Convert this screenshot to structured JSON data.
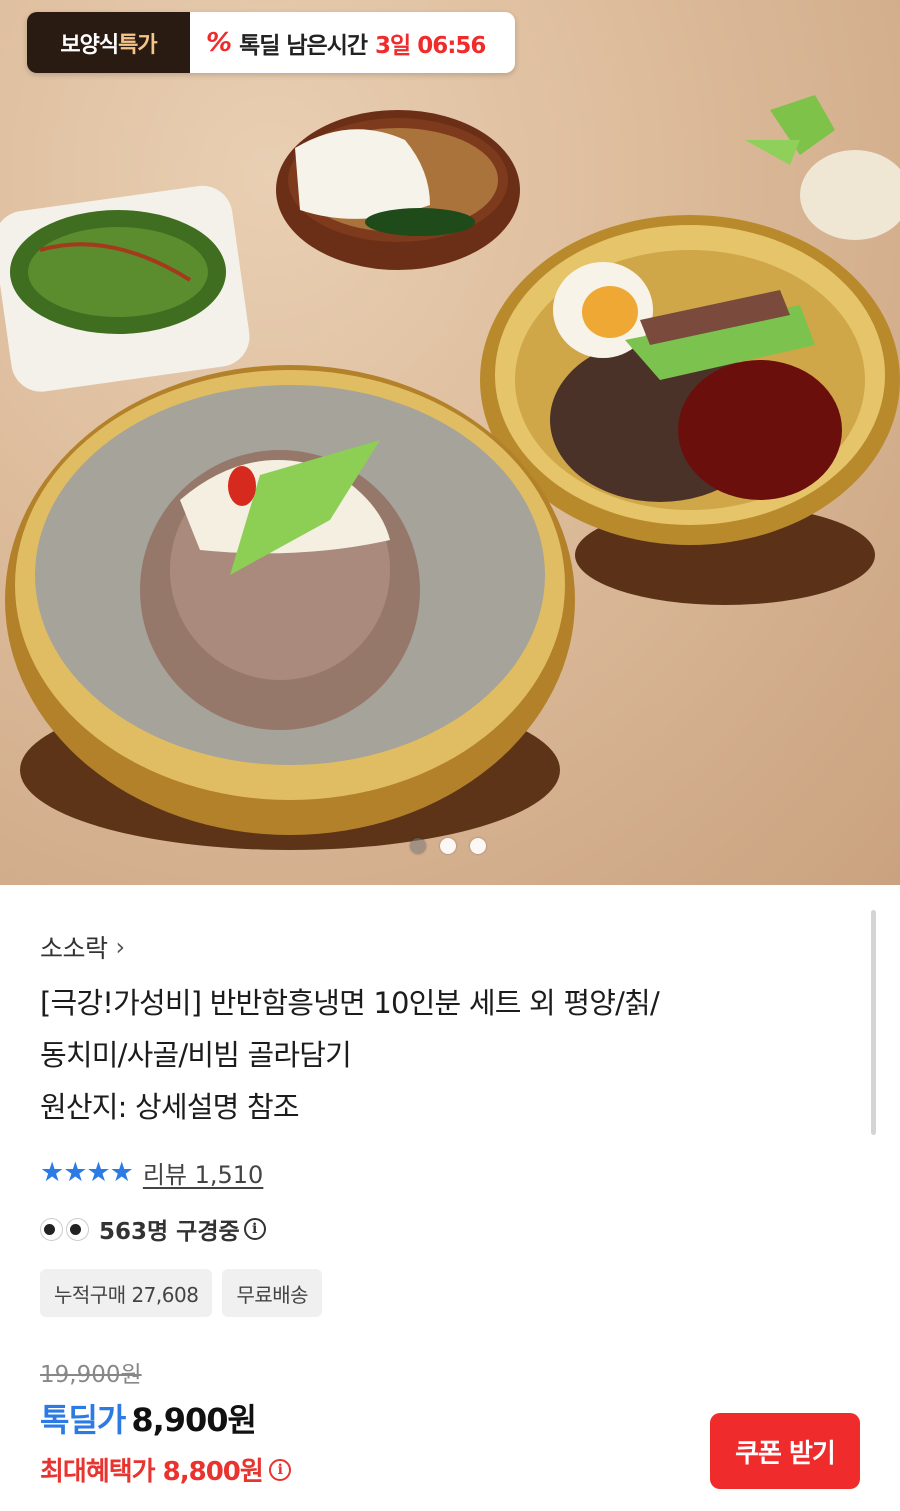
{
  "promo": {
    "brand_a": "보양식",
    "brand_b": "특가",
    "percent_icon": "%",
    "deal_label": "톡딜 남은시간",
    "time_left": "3일 06:56"
  },
  "carousel": {
    "total": 3,
    "active_index": 0
  },
  "product": {
    "seller": "소소락",
    "seller_chevron": "›",
    "title_line1": "[극강!가성비] 반반함흥냉면 10인분 세트 외 평양/칡/",
    "title_line2": "동치미/사골/비빔 골라담기",
    "title_line3": "원산지: 상세설명 참조",
    "stars": "★★★★",
    "rating_value": 4,
    "review_text": "리뷰 1,510",
    "watching_text": "563명 구경중",
    "tags": [
      "누적구매 27,608",
      "무료배송"
    ],
    "original_price": "19,900원",
    "deal_label": "톡딜가",
    "deal_price": "8,900원",
    "max_benefit": "최대혜택가 8,800원",
    "coupon_button": "쿠폰 받기"
  },
  "colors": {
    "accent_blue": "#2c7be5",
    "accent_red": "#ef2b2b"
  }
}
